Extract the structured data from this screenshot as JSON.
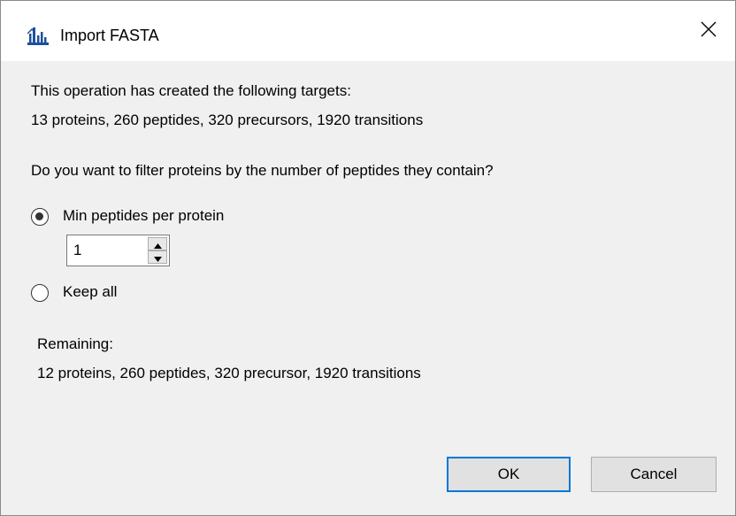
{
  "window": {
    "title": "Import FASTA",
    "app_icon": "skyline-icon",
    "close_icon": "close-icon"
  },
  "summary": {
    "created_label": "This operation has created the following targets:",
    "created_counts": "13 proteins, 260 peptides, 320 precursors, 1920 transitions"
  },
  "filter": {
    "question": "Do you want to filter proteins by the number of peptides they contain?",
    "options": [
      {
        "label": "Min peptides per protein",
        "checked": true
      },
      {
        "label": "Keep all",
        "checked": false
      }
    ],
    "min_peptides_value": "1"
  },
  "remaining": {
    "label": "Remaining:",
    "counts": "12 proteins, 260 peptides, 320 precursor, 1920 transitions"
  },
  "buttons": {
    "ok": "OK",
    "cancel": "Cancel"
  },
  "colors": {
    "accent": "#0078d7",
    "dialog_bg": "#f0f0f0",
    "icon_blue": "#1e4f9c"
  }
}
